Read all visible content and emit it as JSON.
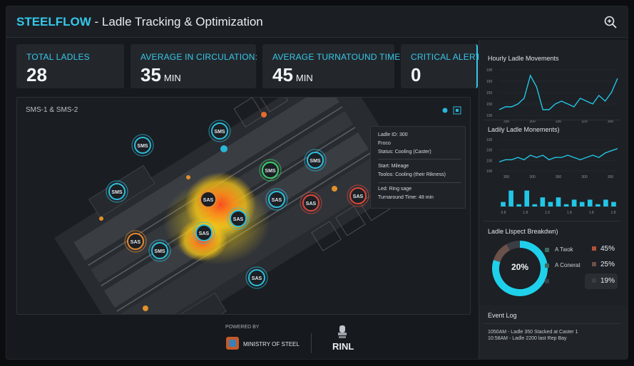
{
  "header": {
    "brand": "STEELFLOW",
    "title_suffix": " - Ladle Tracking & Optimization",
    "zoom_icon": "zoom-search-icon"
  },
  "kpis": [
    {
      "label": "TOTAL LADLES",
      "value": "28",
      "unit": ""
    },
    {
      "label": "AVERAGE IN CIRCULATION:",
      "value": "35",
      "unit": "MIN"
    },
    {
      "label": "AVERAGE TURNATOUND TIME",
      "value": "45",
      "unit": "MIN"
    },
    {
      "label": "CRITICAL ALERTS:",
      "value": "0",
      "unit": ""
    }
  ],
  "map": {
    "title": "SMS-1 & SMS-2",
    "popup": {
      "line1": "Ladle ID: 300",
      "line2": "Froco",
      "line3": "Status: Cooling (Caster)",
      "line4": "Start: Mileage",
      "line5": "Toolos: Cooling (their Rikness)",
      "line6": "Led: Ring sage",
      "line7": "Turnaround Time: 48 min"
    },
    "markers": [
      {
        "label": "SMS",
        "status": "teal"
      },
      {
        "label": "SMS",
        "status": "teal"
      },
      {
        "label": "SMS",
        "status": "teal"
      },
      {
        "label": "SMS",
        "status": "green"
      },
      {
        "label": "SMS",
        "status": "teal"
      },
      {
        "label": "SAS",
        "status": "red"
      },
      {
        "label": "SAS",
        "status": "red"
      },
      {
        "label": "SAS",
        "status": "orange"
      },
      {
        "label": "SAS",
        "status": "orange"
      },
      {
        "label": "SAS",
        "status": "teal"
      },
      {
        "label": "SMS",
        "status": "teal"
      },
      {
        "label": "SAS",
        "status": "teal"
      },
      {
        "label": "SAS",
        "status": "teal"
      },
      {
        "label": "SAS",
        "status": "teal"
      }
    ]
  },
  "sidebar": {
    "hourly_title": "Hourly Ladle Movements",
    "hourly_ticks_y": [
      "100",
      "150",
      "150",
      "150",
      "100"
    ],
    "hourly_ticks_x": [
      "330",
      "300",
      "330",
      "320",
      "300"
    ],
    "ladle_title": "Ladily Ladle Monements)",
    "ladle_ticks_y": [
      "100",
      "100",
      "100",
      "100"
    ],
    "ladle_ticks_x": [
      "300",
      "300",
      "300",
      "300",
      "300"
    ],
    "bar_ticks_x": [
      "0.8",
      "1.8",
      "1.5",
      "1.8",
      "1.8",
      "1.8"
    ],
    "breakdown_title": "Ladle Llspect Breakdwn)",
    "donut_center": "20%",
    "legend": [
      {
        "label": "A Twok",
        "pct": "45%",
        "color": "#1fd0ea"
      },
      {
        "label": "A Conerat",
        "pct": "25%",
        "color": "#6a5149"
      },
      {
        "label": "",
        "pct": "19%",
        "color": "#3a3e44"
      }
    ],
    "event_title": "Event Log",
    "event_line1": "1050AM - Ladle 350 Stacked at Caster 1",
    "event_line2": "10:58AM - Ladle 2200 last Rep Bay"
  },
  "footer": {
    "powered_by": "POWERED BY",
    "ministry": "MINISTRY OF STEEL",
    "rinl": "RINL"
  },
  "chart_data": [
    {
      "type": "line",
      "title": "Hourly Ladle Movements",
      "x": [
        1,
        2,
        3,
        4,
        5,
        6,
        7,
        8,
        9,
        10,
        11,
        12,
        13,
        14,
        15,
        16,
        17,
        18,
        19,
        20
      ],
      "values": [
        2,
        3,
        3,
        4,
        6,
        14,
        10,
        2,
        2,
        4,
        5,
        4,
        3,
        6,
        5,
        4,
        7,
        5,
        8,
        13
      ],
      "ylim": [
        0,
        16
      ]
    },
    {
      "type": "line",
      "title": "Ladily Ladle Monements)",
      "x": [
        1,
        2,
        3,
        4,
        5,
        6,
        7,
        8,
        9,
        10,
        11,
        12,
        13,
        14,
        15,
        16,
        17,
        18,
        19,
        20
      ],
      "values": [
        4,
        5,
        5,
        6,
        5,
        7,
        6,
        7,
        5,
        6,
        6,
        7,
        6,
        5,
        6,
        7,
        6,
        8,
        9,
        10
      ],
      "ylim": [
        0,
        14
      ]
    },
    {
      "type": "bar",
      "title": "",
      "values": [
        2,
        7,
        1,
        7,
        1,
        4,
        2,
        4,
        1,
        3,
        2,
        3,
        1,
        3,
        2
      ],
      "ylim": [
        0,
        10
      ]
    },
    {
      "type": "pie",
      "title": "Ladle Llspect Breakdwn)",
      "categories": [
        "A Twok",
        "A Conerat",
        "Other"
      ],
      "values": [
        80,
        12,
        8
      ]
    }
  ]
}
